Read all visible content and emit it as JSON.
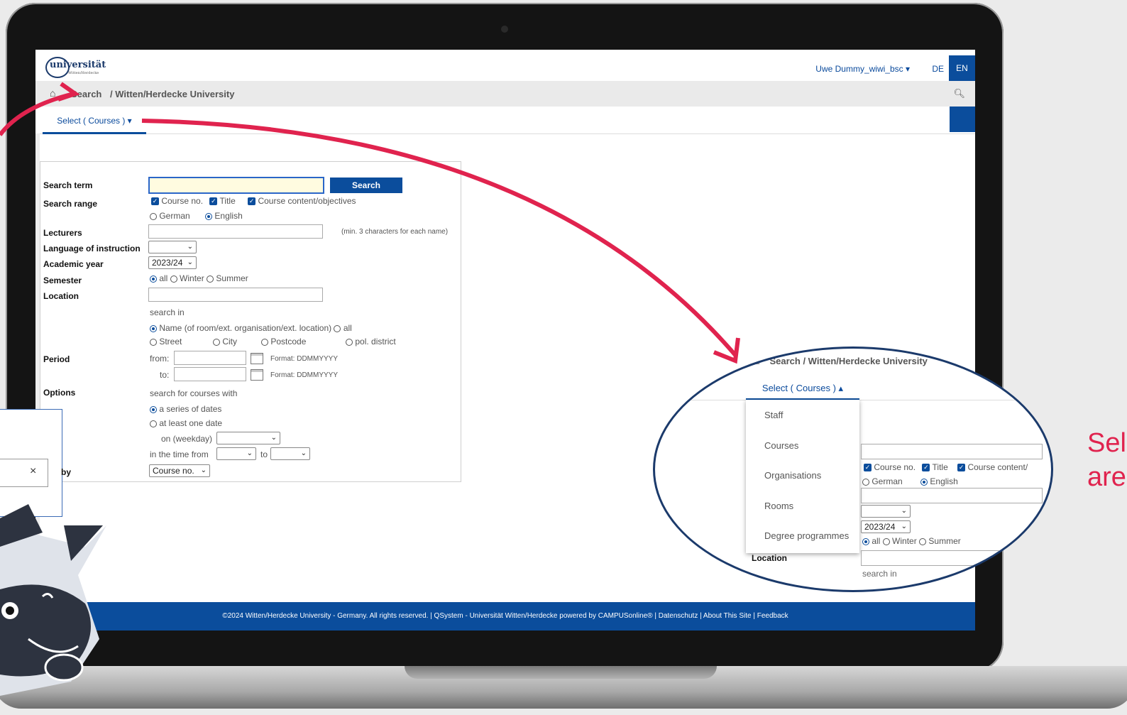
{
  "header": {
    "user": "Uwe Dummy_wiwi_bsc ▾",
    "lang_de": "DE",
    "lang_en": "EN",
    "logo_text": "universität",
    "logo_sub": "Witten/Herdecke"
  },
  "breadcrumb": {
    "search": "Search",
    "university": "/ Witten/Herdecke University"
  },
  "tab": {
    "label": "Select ( Courses ) ▾"
  },
  "form": {
    "search_term_label": "Search term",
    "search_button": "Search",
    "search_range_label": "Search range",
    "cb_course_no": "Course no.",
    "cb_title": "Title",
    "cb_content": "Course content/objectives",
    "r_german": "German",
    "r_english": "English",
    "lecturers_label": "Lecturers",
    "lecturers_hint": "(min. 3 characters for each name)",
    "language_label": "Language of instruction",
    "academic_year_label": "Academic year",
    "academic_year_value": "2023/24",
    "semester_label": "Semester",
    "sem_all": "all",
    "sem_winter": "Winter",
    "sem_summer": "Summer",
    "location_label": "Location",
    "search_in": "search in",
    "loc_name": "Name (of room/ext. organisation/ext. location)",
    "loc_all": "all",
    "loc_street": "Street",
    "loc_city": "City",
    "loc_postcode": "Postcode",
    "loc_district": "pol. district",
    "period_label": "Period",
    "from": "from:",
    "to": "to:",
    "format": "Format: DDMMYYYY",
    "options_label": "Options",
    "search_courses_with": "search for courses with",
    "opt_series": "a series of dates",
    "opt_one": "at least one date",
    "on_weekday": "on (weekday)",
    "time_from": "in the time from",
    "time_to": "to",
    "sort_label": "by",
    "sort_value": "Course no."
  },
  "footer": {
    "text": "©2024 Witten/Herdecke University - Germany. All rights reserved. | QSystem - Universität Witten/Herdecke powered by CAMPUSonline® | Datenschutz | About This Site | Feedback"
  },
  "zoom": {
    "crumb": "Search  / Witten/Herdecke University",
    "tab": "Select ( Courses ) ▴",
    "menu": [
      "Staff",
      "Courses",
      "Organisations",
      "Rooms",
      "Degree programmes"
    ],
    "cb_course_no": "Course no.",
    "cb_title": "Title",
    "cb_content": "Course content/",
    "r_german": "German",
    "r_english": "English",
    "year": "2023/24",
    "sem_all": "all",
    "sem_winter": "Winter",
    "sem_summer": "Summer",
    "location": "Location",
    "search_in": "search in"
  },
  "side_text": {
    "line1": "Sel",
    "line2": "are"
  },
  "colors": {
    "accent": "#0b4d9c",
    "arrow": "#e0234e"
  }
}
